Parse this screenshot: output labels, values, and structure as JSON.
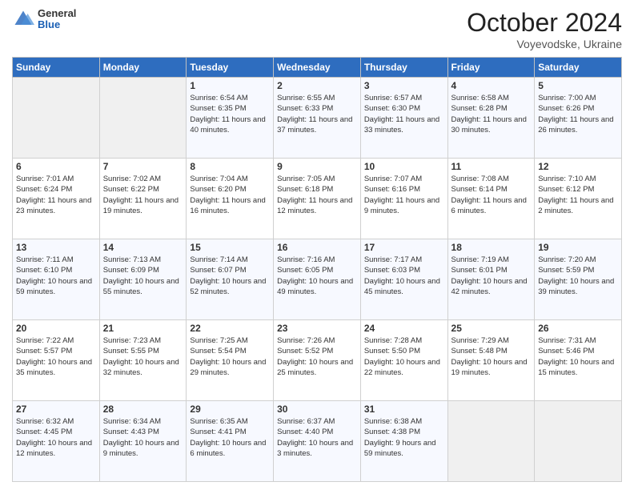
{
  "header": {
    "logo": {
      "line1": "General",
      "line2": "Blue"
    },
    "month": "October 2024",
    "location": "Voyevodske, Ukraine"
  },
  "days_of_week": [
    "Sunday",
    "Monday",
    "Tuesday",
    "Wednesday",
    "Thursday",
    "Friday",
    "Saturday"
  ],
  "weeks": [
    [
      {
        "day": "",
        "empty": true
      },
      {
        "day": "",
        "empty": true
      },
      {
        "day": "1",
        "sunrise": "6:54 AM",
        "sunset": "6:35 PM",
        "daylight": "11 hours and 40 minutes."
      },
      {
        "day": "2",
        "sunrise": "6:55 AM",
        "sunset": "6:33 PM",
        "daylight": "11 hours and 37 minutes."
      },
      {
        "day": "3",
        "sunrise": "6:57 AM",
        "sunset": "6:30 PM",
        "daylight": "11 hours and 33 minutes."
      },
      {
        "day": "4",
        "sunrise": "6:58 AM",
        "sunset": "6:28 PM",
        "daylight": "11 hours and 30 minutes."
      },
      {
        "day": "5",
        "sunrise": "7:00 AM",
        "sunset": "6:26 PM",
        "daylight": "11 hours and 26 minutes."
      }
    ],
    [
      {
        "day": "6",
        "sunrise": "7:01 AM",
        "sunset": "6:24 PM",
        "daylight": "11 hours and 23 minutes."
      },
      {
        "day": "7",
        "sunrise": "7:02 AM",
        "sunset": "6:22 PM",
        "daylight": "11 hours and 19 minutes."
      },
      {
        "day": "8",
        "sunrise": "7:04 AM",
        "sunset": "6:20 PM",
        "daylight": "11 hours and 16 minutes."
      },
      {
        "day": "9",
        "sunrise": "7:05 AM",
        "sunset": "6:18 PM",
        "daylight": "11 hours and 12 minutes."
      },
      {
        "day": "10",
        "sunrise": "7:07 AM",
        "sunset": "6:16 PM",
        "daylight": "11 hours and 9 minutes."
      },
      {
        "day": "11",
        "sunrise": "7:08 AM",
        "sunset": "6:14 PM",
        "daylight": "11 hours and 6 minutes."
      },
      {
        "day": "12",
        "sunrise": "7:10 AM",
        "sunset": "6:12 PM",
        "daylight": "11 hours and 2 minutes."
      }
    ],
    [
      {
        "day": "13",
        "sunrise": "7:11 AM",
        "sunset": "6:10 PM",
        "daylight": "10 hours and 59 minutes."
      },
      {
        "day": "14",
        "sunrise": "7:13 AM",
        "sunset": "6:09 PM",
        "daylight": "10 hours and 55 minutes."
      },
      {
        "day": "15",
        "sunrise": "7:14 AM",
        "sunset": "6:07 PM",
        "daylight": "10 hours and 52 minutes."
      },
      {
        "day": "16",
        "sunrise": "7:16 AM",
        "sunset": "6:05 PM",
        "daylight": "10 hours and 49 minutes."
      },
      {
        "day": "17",
        "sunrise": "7:17 AM",
        "sunset": "6:03 PM",
        "daylight": "10 hours and 45 minutes."
      },
      {
        "day": "18",
        "sunrise": "7:19 AM",
        "sunset": "6:01 PM",
        "daylight": "10 hours and 42 minutes."
      },
      {
        "day": "19",
        "sunrise": "7:20 AM",
        "sunset": "5:59 PM",
        "daylight": "10 hours and 39 minutes."
      }
    ],
    [
      {
        "day": "20",
        "sunrise": "7:22 AM",
        "sunset": "5:57 PM",
        "daylight": "10 hours and 35 minutes."
      },
      {
        "day": "21",
        "sunrise": "7:23 AM",
        "sunset": "5:55 PM",
        "daylight": "10 hours and 32 minutes."
      },
      {
        "day": "22",
        "sunrise": "7:25 AM",
        "sunset": "5:54 PM",
        "daylight": "10 hours and 29 minutes."
      },
      {
        "day": "23",
        "sunrise": "7:26 AM",
        "sunset": "5:52 PM",
        "daylight": "10 hours and 25 minutes."
      },
      {
        "day": "24",
        "sunrise": "7:28 AM",
        "sunset": "5:50 PM",
        "daylight": "10 hours and 22 minutes."
      },
      {
        "day": "25",
        "sunrise": "7:29 AM",
        "sunset": "5:48 PM",
        "daylight": "10 hours and 19 minutes."
      },
      {
        "day": "26",
        "sunrise": "7:31 AM",
        "sunset": "5:46 PM",
        "daylight": "10 hours and 15 minutes."
      }
    ],
    [
      {
        "day": "27",
        "sunrise": "6:32 AM",
        "sunset": "4:45 PM",
        "daylight": "10 hours and 12 minutes."
      },
      {
        "day": "28",
        "sunrise": "6:34 AM",
        "sunset": "4:43 PM",
        "daylight": "10 hours and 9 minutes."
      },
      {
        "day": "29",
        "sunrise": "6:35 AM",
        "sunset": "4:41 PM",
        "daylight": "10 hours and 6 minutes."
      },
      {
        "day": "30",
        "sunrise": "6:37 AM",
        "sunset": "4:40 PM",
        "daylight": "10 hours and 3 minutes."
      },
      {
        "day": "31",
        "sunrise": "6:38 AM",
        "sunset": "4:38 PM",
        "daylight": "9 hours and 59 minutes."
      },
      {
        "day": "",
        "empty": true
      },
      {
        "day": "",
        "empty": true
      }
    ]
  ],
  "labels": {
    "sunrise": "Sunrise:",
    "sunset": "Sunset:",
    "daylight": "Daylight:"
  }
}
